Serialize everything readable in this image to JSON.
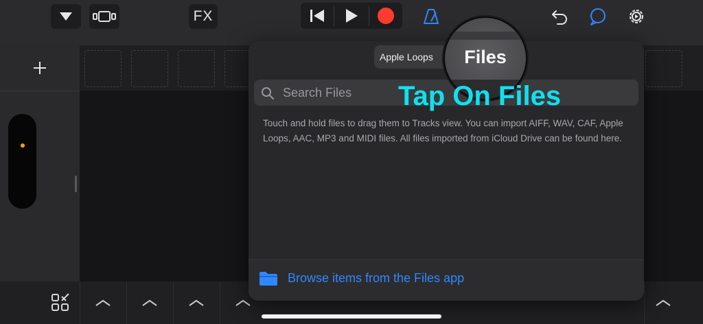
{
  "toolbar": {
    "fx_label": "FX",
    "icons": [
      "dropdown-arrow-icon",
      "track-view-icon",
      "rewind-icon",
      "play-icon",
      "record-icon",
      "metronome-icon",
      "undo-icon",
      "loop-browser-icon",
      "settings-icon"
    ]
  },
  "popover": {
    "tabs": {
      "apple_loops": "Apple Loops",
      "files": "Files"
    },
    "search_placeholder": "Search Files",
    "help_text": "Touch and hold files to drag them to Tracks view. You can import AIFF, WAV, CAF, Apple Loops, AAC, MP3 and MIDI files. All files imported from iCloud Drive can be found here.",
    "browse_label": "Browse items from the Files app"
  },
  "annotation": {
    "text": "Tap On Files"
  },
  "colors": {
    "accent_blue": "#2f88ff",
    "record_red": "#ff3b30",
    "annotation_cyan": "#10e0f0",
    "knob_dot": "#ff9f0a"
  }
}
